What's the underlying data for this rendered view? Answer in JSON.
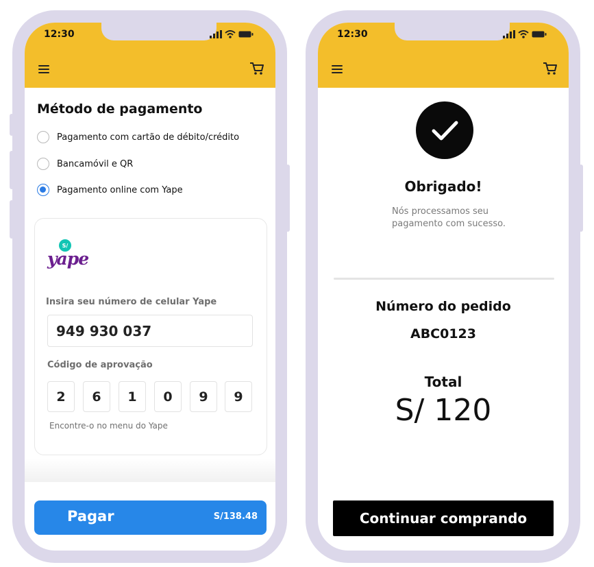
{
  "left_screen": {
    "status_time": "12:30",
    "section_title": "Método de pagamento",
    "payment_options": [
      {
        "label": "Pagamento com cartão de débito/crédito",
        "selected": false
      },
      {
        "label": "Bancamóvil e QR",
        "selected": false
      },
      {
        "label": "Pagamento online com Yape",
        "selected": true
      }
    ],
    "yape_logo": {
      "badge": "S/",
      "word": "yape"
    },
    "phone_label": "Insira seu número de celular Yape",
    "phone_value": "949 930 037",
    "code_label": "Código de aprovação",
    "code_digits": [
      "2",
      "6",
      "1",
      "0",
      "9",
      "9"
    ],
    "code_hint": "Encontre-o no menu do Yape",
    "pay_button": {
      "label": "Pagar",
      "amount": "S/138.48"
    }
  },
  "right_screen": {
    "status_time": "12:30",
    "thanks_title": "Obrigado!",
    "thanks_message_line1": "Nós processamos seu",
    "thanks_message_line2": "pagamento com sucesso.",
    "order_label": "Número do pedido",
    "order_number": "ABC0123",
    "total_label": "Total",
    "total_value": "S/ 120",
    "continue_button": "Continuar comprando"
  },
  "colors": {
    "header": "#f3be2b",
    "frame": "#dcd8ea",
    "accent_blue": "#2787e8",
    "yape_purple": "#6b1f8f",
    "yape_teal": "#11c5b4"
  },
  "icons": [
    "menu-icon",
    "cart-icon",
    "signal-icon",
    "wifi-icon",
    "battery-icon",
    "check-icon"
  ]
}
